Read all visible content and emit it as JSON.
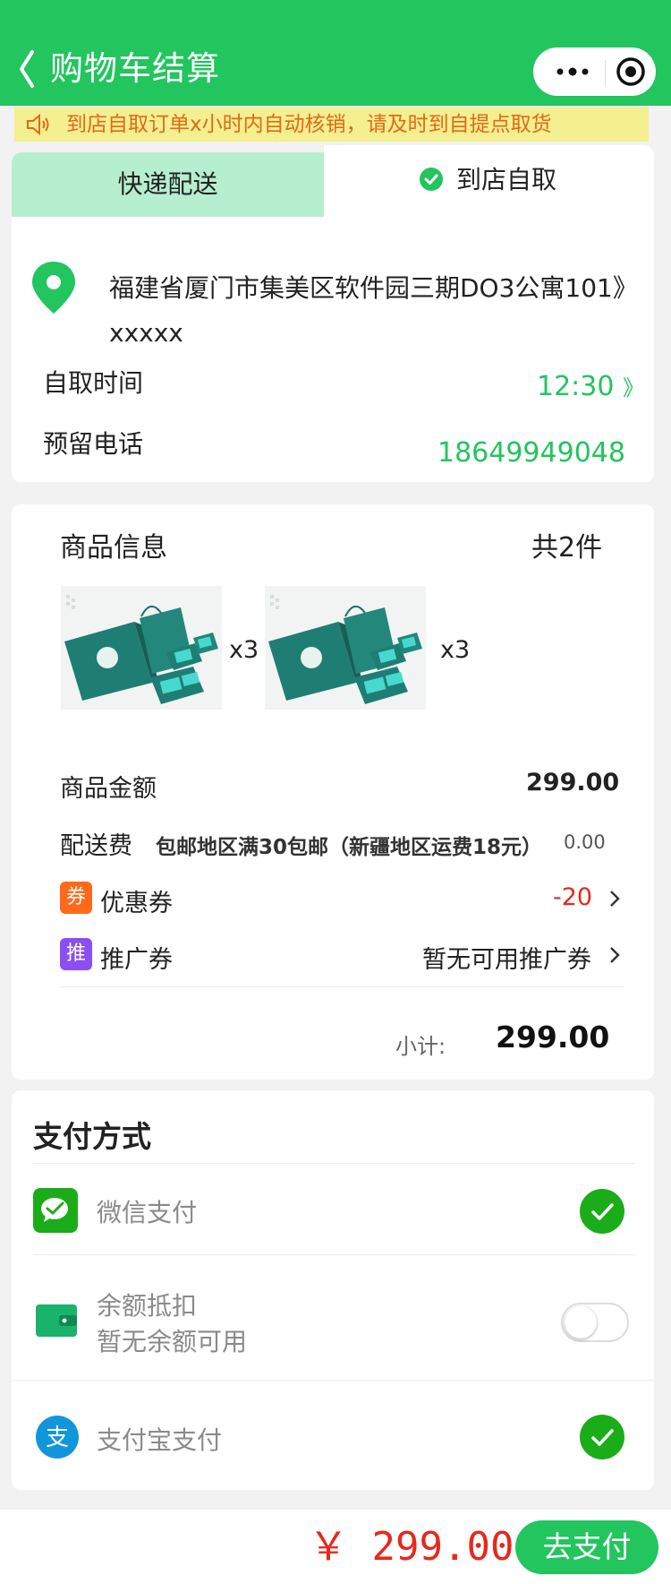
{
  "header": {
    "title": "购物车结算"
  },
  "notice": {
    "text": "到店自取订单x小时内自动核销，请及时到自提点取货"
  },
  "tabs": [
    {
      "label": "快递配送"
    },
    {
      "label": "到店自取"
    }
  ],
  "address": {
    "line1": "福建省厦门市集美区软件园三期DO3公寓101",
    "line2": "xxxxx",
    "arrow": "》",
    "pickup_time_label": "自取时间",
    "pickup_time_value": "12:30",
    "pickup_time_arrow": "》",
    "phone_label": "预留电话",
    "phone_value": "18649949048"
  },
  "goods": {
    "title": "商品信息",
    "count_text": "共2件",
    "items": [
      {
        "qty": "x3"
      },
      {
        "qty": "x3"
      }
    ],
    "amount_label": "商品金额",
    "amount_value": "299.00",
    "shipping_label": "配送费",
    "shipping_note": "包邮地区满30包邮（新疆地区运费18元）",
    "shipping_value": "0.00",
    "coupon_badge": "券",
    "coupon_label": "优惠券",
    "coupon_value": "-20",
    "promo_badge": "推",
    "promo_label": "推广券",
    "promo_value": "暂无可用推广券",
    "subtotal_label": "小计:",
    "subtotal_value": "299.00"
  },
  "payment": {
    "title": "支付方式",
    "wechat_label": "微信支付",
    "balance_label": "余额抵扣",
    "balance_note": "暂无余额可用",
    "alipay_label": "支付宝支付",
    "alipay_glyph": "支"
  },
  "footer": {
    "total": "￥ 299.00",
    "pay_button": "去支付"
  },
  "colors": {
    "brand_green": "#22c55e",
    "price_red": "#e8271d",
    "notice_bg": "#f4ef8f"
  }
}
